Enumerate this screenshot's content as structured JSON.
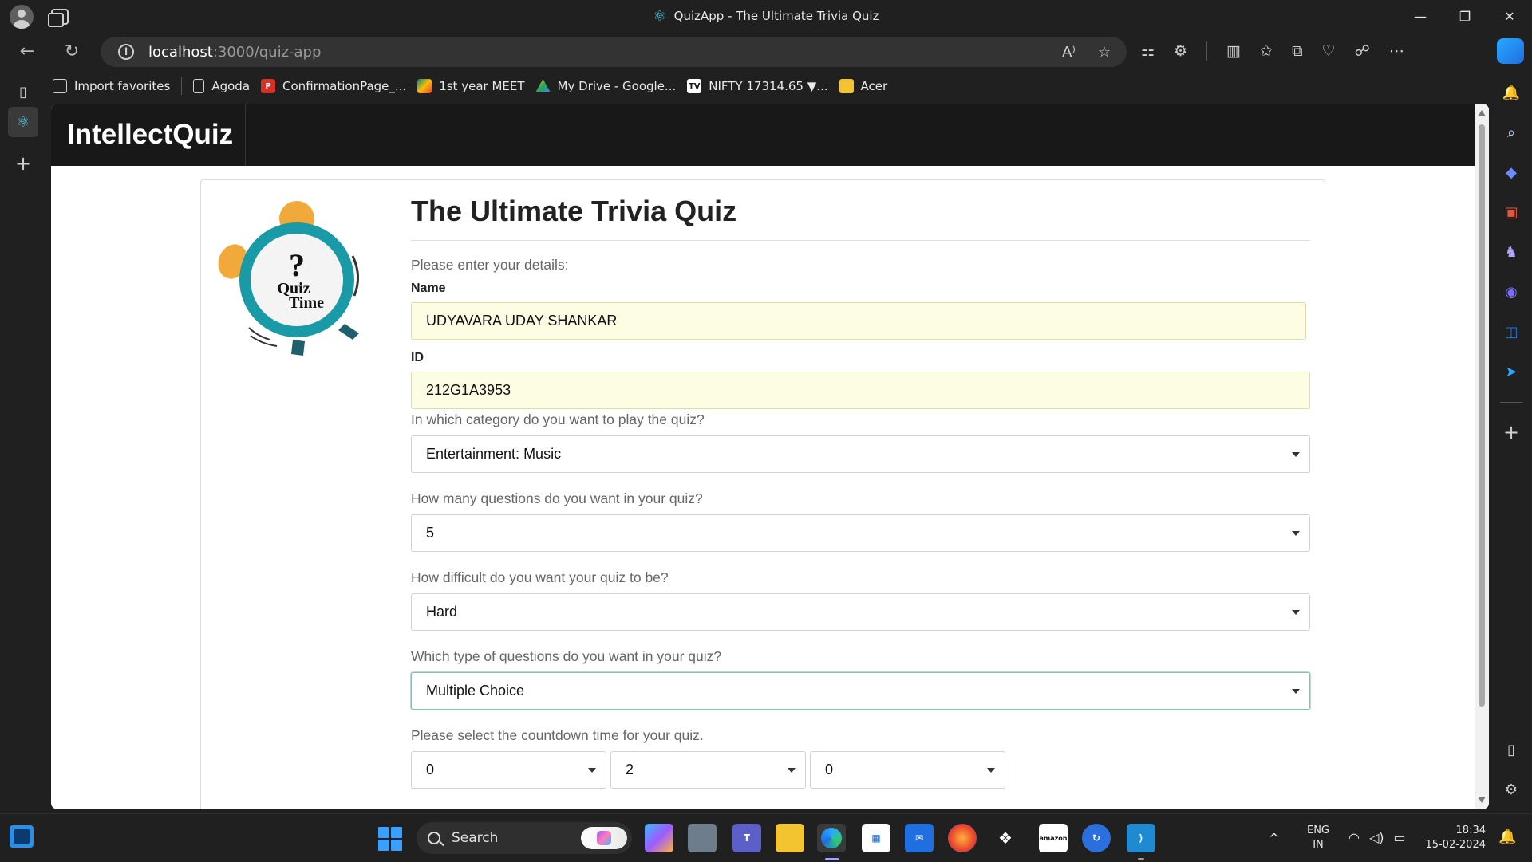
{
  "browser": {
    "window_title": "QuizApp - The Ultimate Trivia Quiz",
    "url_host": "localhost",
    "url_path": ":3000/quiz-app",
    "read_aloud": "A⁾",
    "favorites": [
      {
        "label": "Import favorites",
        "icon": "import-icon",
        "color": "#cfcfcf"
      },
      {
        "label": "Agoda",
        "icon": "page-icon",
        "color": "#cfcfcf"
      },
      {
        "label": "ConfirmationPage_...",
        "icon": "pdf-icon",
        "color": "#d93025"
      },
      {
        "label": "1st year MEET",
        "icon": "meet-icon",
        "color": "#00897b"
      },
      {
        "label": "My Drive - Google...",
        "icon": "drive-icon",
        "color": "#1fa463"
      },
      {
        "label": "NIFTY 17314.65 ▼...",
        "icon": "tradingview-icon",
        "color": "#131722"
      },
      {
        "label": "Acer",
        "icon": "folder-icon",
        "color": "#f4c430"
      }
    ]
  },
  "app": {
    "brand": "IntellectQuiz",
    "logo_text_line1": "Quiz",
    "logo_text_line2": "Time",
    "logo_symbol": "?"
  },
  "form": {
    "title": "The Ultimate Trivia Quiz",
    "intro": "Please enter your details:",
    "name_label": "Name",
    "name_value": "UDYAVARA UDAY SHANKAR",
    "id_label": "ID",
    "id_value": "212G1A3953",
    "category_label": "In which category do you want to play the quiz?",
    "category_value": "Entertainment: Music",
    "count_label": "How many questions do you want in your quiz?",
    "count_value": "5",
    "difficulty_label": "How difficult do you want your quiz to be?",
    "difficulty_value": "Hard",
    "type_label": "Which type of questions do you want in your quiz?",
    "type_value": "Multiple Choice",
    "countdown_label": "Please select the countdown time for your quiz.",
    "countdown_hours": "0",
    "countdown_minutes": "2",
    "countdown_seconds": "0"
  },
  "taskbar": {
    "search_text": "Search",
    "language_line1": "ENG",
    "language_line2": "IN",
    "time": "18:34",
    "date": "15-02-2024"
  },
  "colors": {
    "accent": "#2a8fe8",
    "input_autofill": "#fdfde3",
    "logo_teal": "#1a9aa6",
    "logo_orange": "#f0a93a"
  }
}
